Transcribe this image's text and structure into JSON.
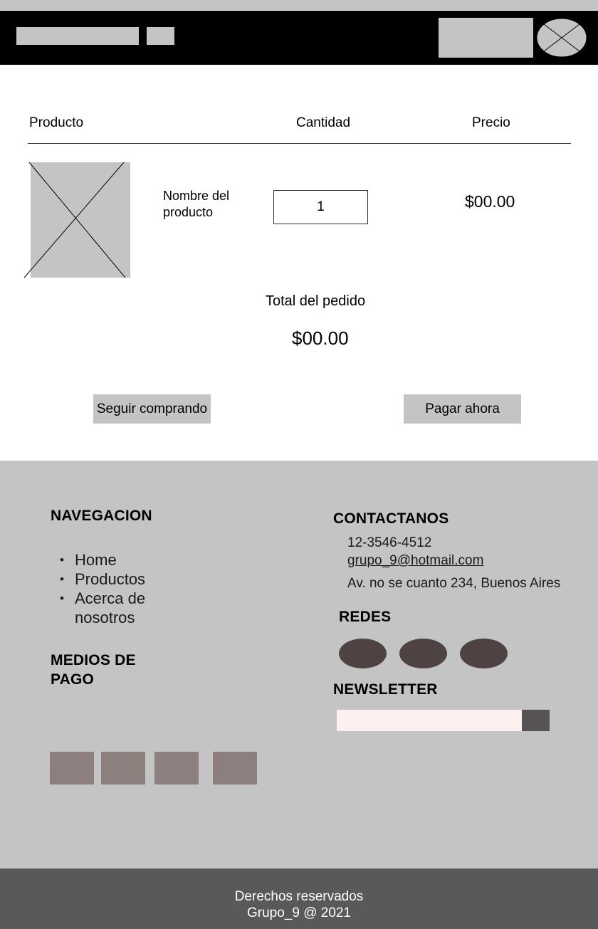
{
  "table": {
    "header_product": "Producto",
    "header_quantity": "Cantidad",
    "header_price": "Precio",
    "item": {
      "name": "Nombre del producto",
      "quantity": "1",
      "price": "$00.00"
    }
  },
  "order": {
    "total_label": "Total del pedido",
    "total_value": "$00.00"
  },
  "buttons": {
    "continue_shopping": "Seguir comprando",
    "pay_now": "Pagar ahora"
  },
  "footer": {
    "nav_title": "NAVEGACION",
    "nav_items": [
      "Home",
      "Productos",
      "Acerca de nosotros"
    ],
    "payment_title": "MEDIOS DE PAGO",
    "contact_title": "CONTACTANOS",
    "phone": "12-3546-4512",
    "email": "grupo_9@hotmail.com",
    "address": "Av. no se cuanto 234, Buenos Aires",
    "social_title": "REDES",
    "newsletter_title": "NEWSLETTER",
    "newsletter_value": ""
  },
  "bottom": {
    "line1": "Derechos reservados",
    "line2": "Grupo_9 @ 2021"
  },
  "colors": {
    "placeholder_gray": "#c4c4c4",
    "header_black": "#000000",
    "social_circle": "#4f4242",
    "payment_box": "#8e7f7f",
    "newsletter_input": "#fdf0f0",
    "newsletter_button": "#575254",
    "bottom_bar": "#595959"
  }
}
